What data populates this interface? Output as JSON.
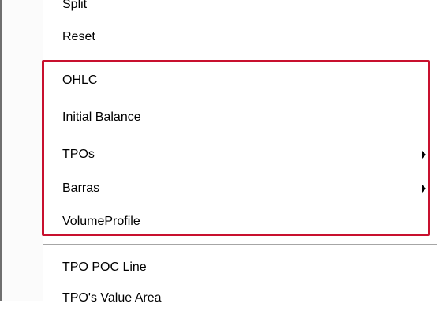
{
  "menu": {
    "items": [
      {
        "label": "Split",
        "has_submenu": false
      },
      {
        "label": "Reset",
        "has_submenu": false
      },
      {
        "label": "OHLC",
        "has_submenu": false
      },
      {
        "label": "Initial Balance",
        "has_submenu": false
      },
      {
        "label": "TPOs",
        "has_submenu": true
      },
      {
        "label": "Barras",
        "has_submenu": true
      },
      {
        "label": "VolumeProfile",
        "has_submenu": false
      },
      {
        "label": "TPO POC Line",
        "has_submenu": false
      },
      {
        "label": "TPO's Value Area",
        "has_submenu": false
      }
    ]
  },
  "colors": {
    "highlight_border": "#c8102e",
    "menu_background": "#ffffff",
    "gutter_background": "#fbfbfb"
  }
}
